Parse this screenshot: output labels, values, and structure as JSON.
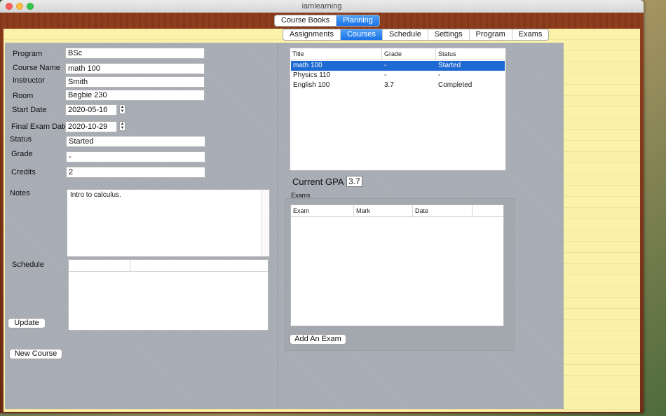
{
  "window": {
    "title": "iamlearning"
  },
  "top_tabs": [
    {
      "label": "Course Books",
      "selected": false
    },
    {
      "label": "Planning",
      "selected": true
    }
  ],
  "sub_tabs": [
    {
      "label": "Assignments",
      "selected": false
    },
    {
      "label": "Courses",
      "selected": true
    },
    {
      "label": "Schedule",
      "selected": false
    },
    {
      "label": "Settings",
      "selected": false
    },
    {
      "label": "Program",
      "selected": false
    },
    {
      "label": "Exams",
      "selected": false
    }
  ],
  "form": {
    "program_label": "Program",
    "program_value": "BSc",
    "course_name_label": "Course Name",
    "course_name_value": "math 100",
    "instructor_label": "Instructor",
    "instructor_value": "Smith",
    "room_label": "Room",
    "room_value": "Begbie 230",
    "start_date_label": "Start Date",
    "start_date_value": "2020-05-16",
    "final_exam_label": "Final Exam Date",
    "final_exam_value": "2020-10-29",
    "status_label": "Status",
    "status_value": "Started",
    "grade_label": "Grade",
    "grade_value": "-",
    "credits_label": "Credits",
    "credits_value": "2",
    "notes_label": "Notes",
    "notes_value": "Intro to calculus.",
    "schedule_label": "Schedule",
    "update_button": "Update",
    "new_course_button": "New Course"
  },
  "courses_table": {
    "headers": [
      "Title",
      "Grade",
      "Status"
    ],
    "rows": [
      {
        "title": "math 100",
        "grade": "-",
        "status": "Started",
        "selected": true
      },
      {
        "title": "Physics 110",
        "grade": "-",
        "status": "-",
        "selected": false
      },
      {
        "title": "English 100",
        "grade": "3.7",
        "status": "Completed",
        "selected": false
      }
    ]
  },
  "gpa": {
    "label": "Current GPA :",
    "value": "3.7"
  },
  "exams": {
    "label": "Exams",
    "headers": [
      "Exam",
      "Mark",
      "Date"
    ],
    "add_button": "Add An Exam"
  },
  "colors": {
    "selection": "#1d6ad2",
    "segment_selected": "#1b74e8",
    "panel": "#a9adb5",
    "paper": "#fbf2a9",
    "wood": "#7a3016"
  }
}
